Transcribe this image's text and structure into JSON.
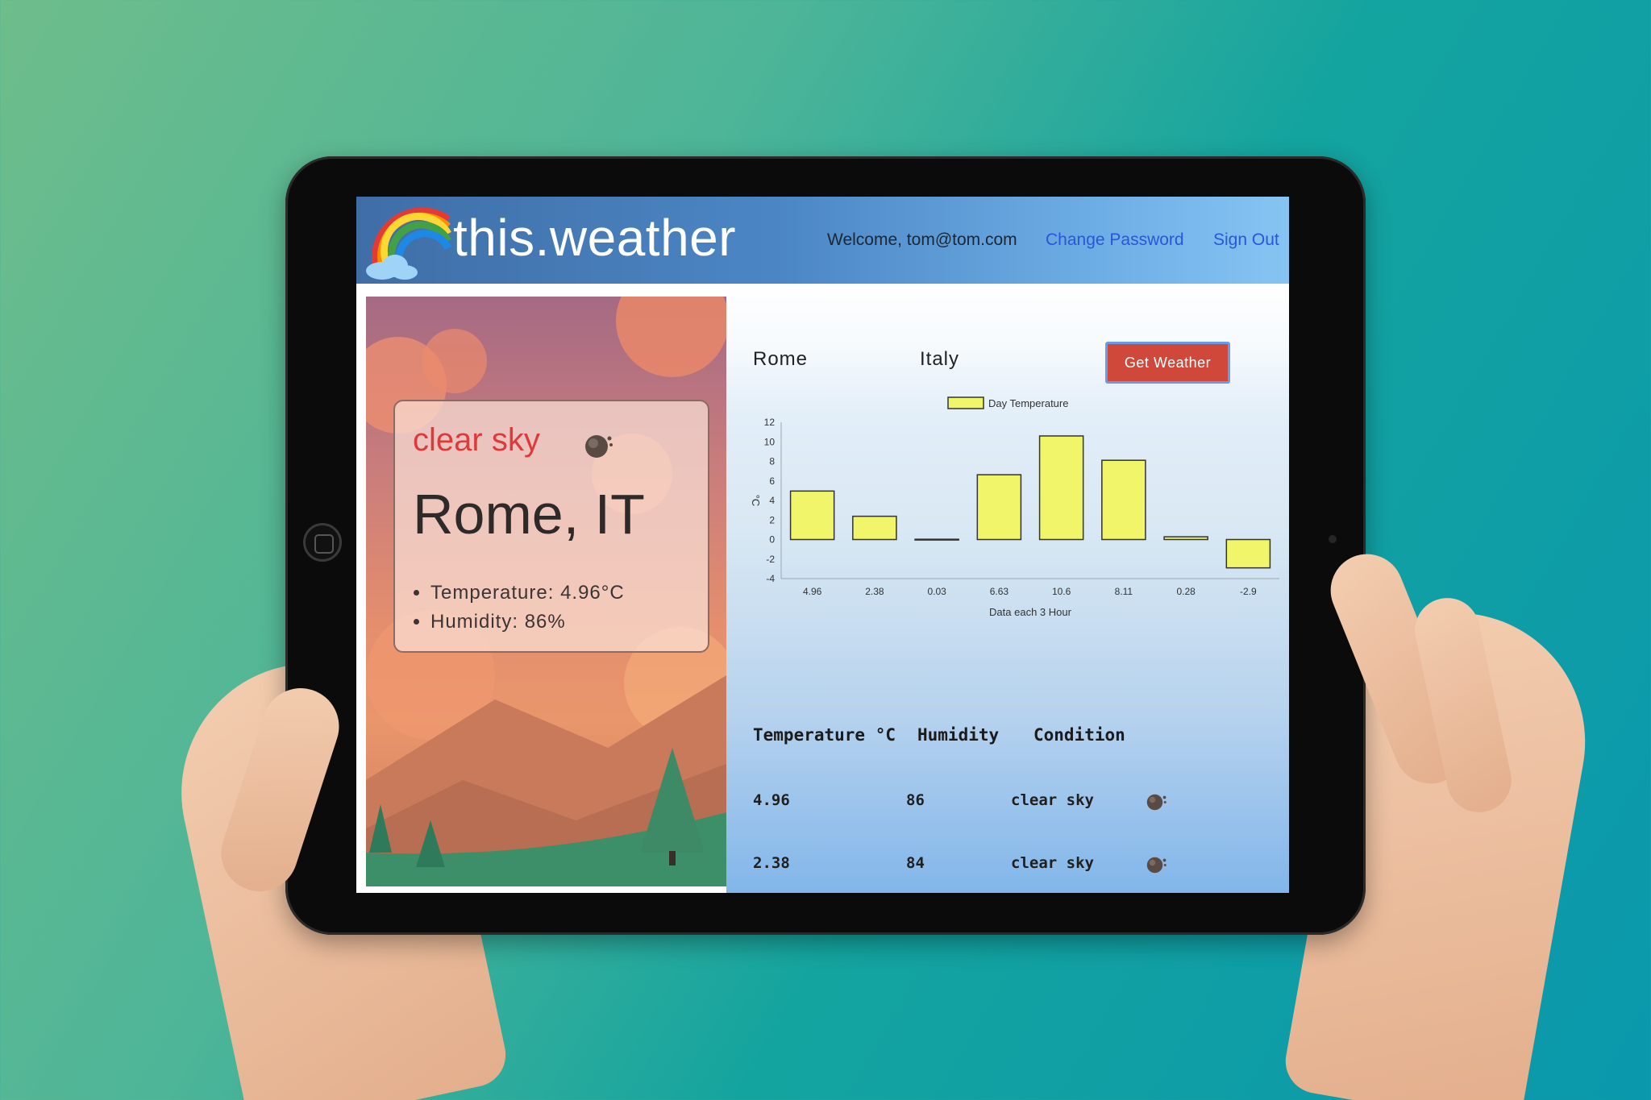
{
  "app": {
    "title": "this.weather",
    "welcome": "Welcome, tom@tom.com",
    "change_password": "Change Password",
    "sign_out": "Sign Out"
  },
  "current": {
    "condition": "clear sky",
    "condition_icon": "moon-cloud-icon",
    "city": "Rome, IT",
    "temperature": "Temperature: 4.96°C",
    "humidity": "Humidity: 86%"
  },
  "search": {
    "city": "Rome",
    "country": "Italy",
    "button": "Get Weather"
  },
  "chart_data": {
    "type": "bar",
    "title": "",
    "legend": [
      "Day Temperature"
    ],
    "legend_position": "top-center",
    "xlabel": "Data each 3 Hour",
    "ylabel": "°C",
    "ylim": [
      -4,
      12
    ],
    "yticks": [
      12,
      10,
      8,
      6,
      4,
      2,
      0,
      -2,
      -4
    ],
    "categories": [
      "4.96",
      "2.38",
      "0.03",
      "6.63",
      "10.6",
      "8.11",
      "0.28",
      "-2.9"
    ],
    "series": [
      {
        "name": "Day Temperature",
        "values": [
          4.96,
          2.38,
          0.03,
          6.63,
          10.6,
          8.11,
          0.28,
          -2.9
        ]
      }
    ],
    "bar_color": "#f1f56a",
    "grid": false
  },
  "table": {
    "headers": [
      "Temperature °C",
      "Humidity",
      "Condition"
    ],
    "rows": [
      {
        "temperature": "4.96",
        "humidity": "86",
        "condition": "clear sky",
        "icon": "moon-cloud-icon"
      },
      {
        "temperature": "2.38",
        "humidity": "84",
        "condition": "clear sky",
        "icon": "moon-cloud-icon"
      }
    ]
  }
}
